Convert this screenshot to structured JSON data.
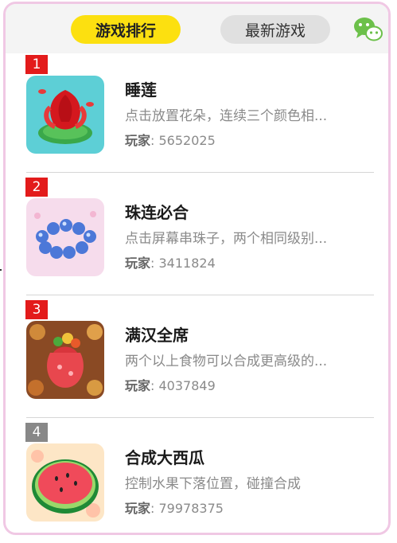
{
  "tabs": {
    "active_label": "游戏排行",
    "inactive_label": "最新游戏"
  },
  "icons": {
    "share": "wechat-icon"
  },
  "games": [
    {
      "rank": "1",
      "title": "睡莲",
      "desc": "点击放置花朵，连续三个颜色相...",
      "players_label": "玩家",
      "players_value": ": 5652025"
    },
    {
      "rank": "2",
      "title": "珠连必合",
      "desc": "点击屏幕串珠子，两个相同级别...",
      "players_label": "玩家",
      "players_value": ": 3411824"
    },
    {
      "rank": "3",
      "title": "满汉全席",
      "desc": "两个以上食物可以合成更高级的...",
      "players_label": "玩家",
      "players_value": ": 4037849"
    },
    {
      "rank": "4",
      "title": "合成大西瓜",
      "desc": "控制水果下落位置，碰撞合成",
      "players_label": "玩家",
      "players_value": ": 79978375"
    }
  ],
  "colors": {
    "active_tab": "#fce010",
    "rank_top": "#e31b1b",
    "rank_other": "#888888",
    "frame_border": "#f0c8e4"
  }
}
